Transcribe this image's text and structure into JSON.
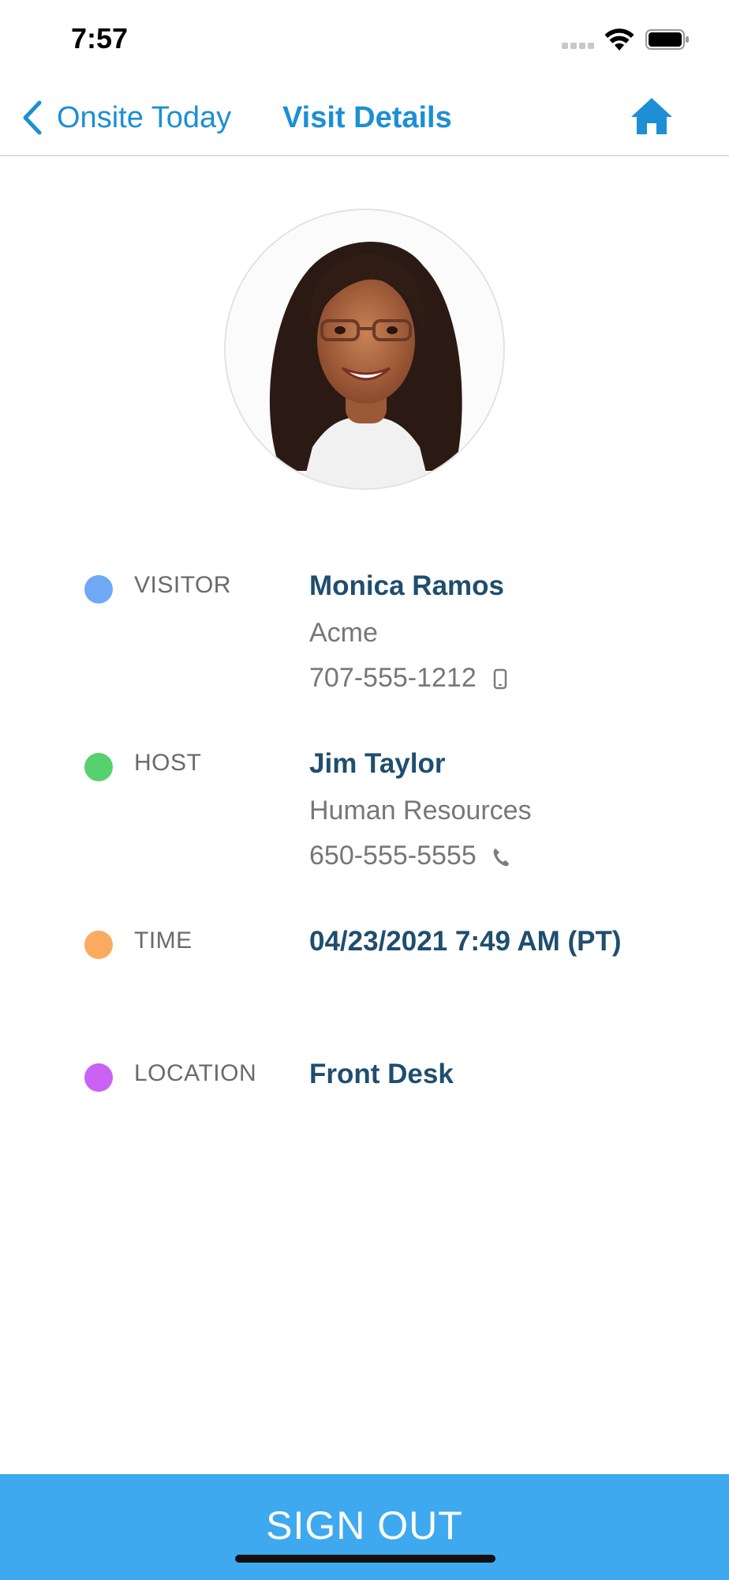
{
  "status_bar": {
    "time": "7:57"
  },
  "nav": {
    "back_label": "Onsite Today",
    "title": "Visit Details",
    "accent_color": "#1d8fd4"
  },
  "avatar": {
    "description_icon": "visitor-photo"
  },
  "details": {
    "visitor": {
      "label": "VISITOR",
      "name": "Monica Ramos",
      "company": "Acme",
      "phone": "707-555-1212",
      "phone_icon": "mobile-phone-icon",
      "dot_color": "#6fa8f5"
    },
    "host": {
      "label": "HOST",
      "name": "Jim Taylor",
      "department": "Human Resources",
      "phone": "650-555-5555",
      "phone_icon": "phone-handset-icon",
      "dot_color": "#57d06e"
    },
    "time": {
      "label": "TIME",
      "value": "04/23/2021 7:49 AM (PT)",
      "dot_color": "#fbab60"
    },
    "location": {
      "label": "LOCATION",
      "value": "Front Desk",
      "dot_color": "#c962f5"
    }
  },
  "footer": {
    "signout_label": "SIGN OUT",
    "button_color": "#3ea9ef"
  }
}
